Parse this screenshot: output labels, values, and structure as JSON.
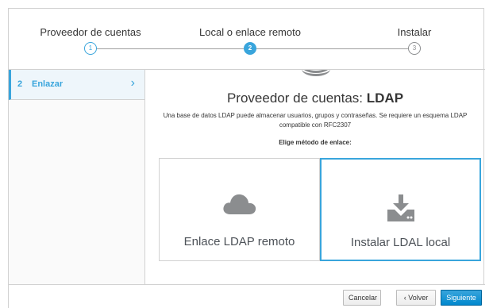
{
  "stepper": {
    "steps": [
      {
        "label": "Proveedor de cuentas",
        "number": "1",
        "state": "done"
      },
      {
        "label": "Local o enlace remoto",
        "number": "2",
        "state": "active"
      },
      {
        "label": "Instalar",
        "number": "3",
        "state": "pending"
      }
    ]
  },
  "sidebar": {
    "items": [
      {
        "number": "2",
        "label": "Enlazar",
        "chevron": "›"
      }
    ]
  },
  "main": {
    "title_prefix": "Proveedor de cuentas: ",
    "title_strong": "LDAP",
    "description": "Una base de datos LDAP puede almacenar usuarios, grupos y contraseñas. Se requiere un esquema LDAP compatible con RFC2307",
    "subheading": "Elige método de enlace:",
    "cards": [
      {
        "label": "Enlace LDAP remoto",
        "icon": "cloud-icon",
        "selected": false
      },
      {
        "label": "Instalar LDAL local",
        "icon": "download-server-icon",
        "selected": true
      }
    ]
  },
  "footer": {
    "cancel_label": "Cancelar",
    "back_label": "‹ Volver",
    "next_label": "Siguiente ›"
  },
  "colors": {
    "accent": "#39a5dc",
    "icon_gray": "#8b8d8f"
  }
}
